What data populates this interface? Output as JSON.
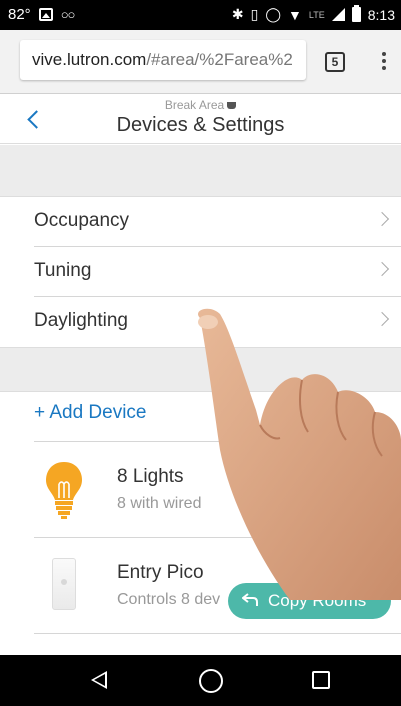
{
  "status_bar": {
    "temperature": "82°",
    "time": "8:13",
    "network": "4G LTE"
  },
  "browser": {
    "url_host": "vive.lutron.com",
    "url_path": "/#area/%2Farea%2",
    "tab_count": "5"
  },
  "header": {
    "subtitle": "Break Area",
    "title": "Devices & Settings"
  },
  "settings_list": [
    {
      "label": "Occupancy"
    },
    {
      "label": "Tuning"
    },
    {
      "label": "Daylighting"
    }
  ],
  "add_device_label": "+ Add Device",
  "devices": [
    {
      "name": "8 Lights",
      "description": "8 with wired",
      "icon": "light-bulb-icon"
    },
    {
      "name": "Entry Pico",
      "description": "Controls 8 dev",
      "icon": "pico-remote-icon"
    }
  ],
  "fab": {
    "label": "Copy Rooms",
    "icon": "return-arrow-icon"
  },
  "colors": {
    "accent_blue": "#1a78c2",
    "fab_teal": "#4db8a9",
    "bulb_orange": "#f5a623"
  }
}
